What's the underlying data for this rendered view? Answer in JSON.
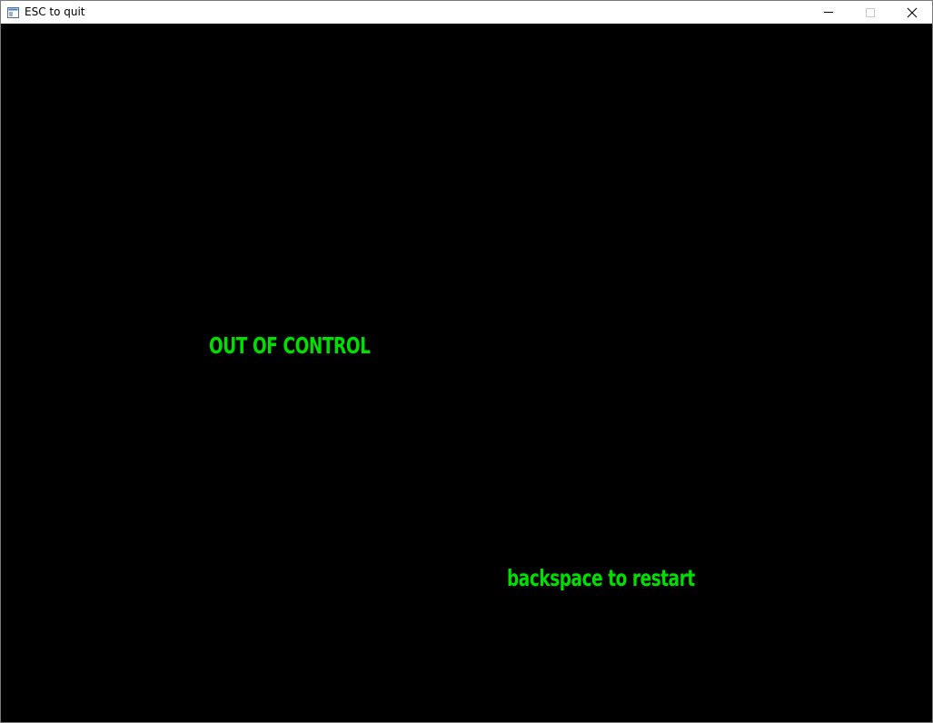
{
  "window": {
    "title": "ESC to quit",
    "icon": "app-window-icon",
    "controls": {
      "minimize_icon": "minimize-icon",
      "maximize_icon": "maximize-icon",
      "close_icon": "close-icon"
    }
  },
  "game": {
    "background_color": "#000000",
    "text_color": "#00e000",
    "headline": "OUT OF CONTROL",
    "restart_hint": "backspace to restart"
  }
}
